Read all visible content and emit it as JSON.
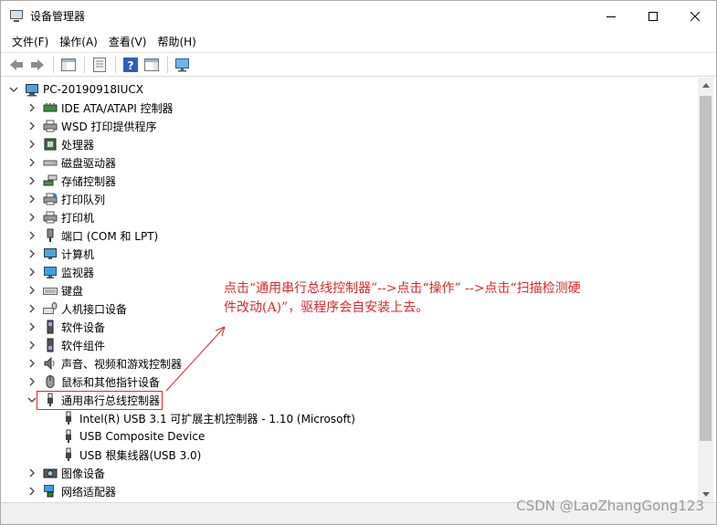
{
  "window": {
    "title": "设备管理器"
  },
  "menu": [
    "文件(F)",
    "操作(A)",
    "查看(V)",
    "帮助(H)"
  ],
  "tree": {
    "root": "PC-20190918IUCX",
    "categories": [
      {
        "label": "IDE ATA/ATAPI 控制器",
        "icon": "ide-controller-icon"
      },
      {
        "label": "WSD 打印提供程序",
        "icon": "printer-icon"
      },
      {
        "label": "处理器",
        "icon": "processor-icon"
      },
      {
        "label": "磁盘驱动器",
        "icon": "disk-drive-icon"
      },
      {
        "label": "存储控制器",
        "icon": "storage-controller-icon"
      },
      {
        "label": "打印队列",
        "icon": "print-queue-icon"
      },
      {
        "label": "打印机",
        "icon": "printer-icon"
      },
      {
        "label": "端口 (COM 和 LPT)",
        "icon": "port-icon"
      },
      {
        "label": "计算机",
        "icon": "computer-icon"
      },
      {
        "label": "监视器",
        "icon": "monitor-icon"
      },
      {
        "label": "键盘",
        "icon": "keyboard-icon"
      },
      {
        "label": "人机接口设备",
        "icon": "hid-icon"
      },
      {
        "label": "软件设备",
        "icon": "software-device-icon"
      },
      {
        "label": "软件组件",
        "icon": "software-component-icon"
      },
      {
        "label": "声音、视频和游戏控制器",
        "icon": "speaker-icon"
      },
      {
        "label": "鼠标和其他指针设备",
        "icon": "mouse-icon"
      },
      {
        "label": "通用串行总线控制器",
        "icon": "usb-icon",
        "expanded": true,
        "highlighted": true,
        "children": [
          "Intel(R) USB 3.1 可扩展主机控制器 - 1.10 (Microsoft)",
          "USB Composite Device",
          "USB 根集线器(USB 3.0)"
        ]
      },
      {
        "label": "图像设备",
        "icon": "camera-icon"
      },
      {
        "label": "网络适配器",
        "icon": "network-adapter-icon"
      }
    ]
  },
  "annotation": {
    "line1": "点击“通用串行总线控制器”-->点击“操作” -->点击“扫描检测硬",
    "line2": "件改动(A)”，驱程序会自安装上去。"
  },
  "watermark": "CSDN @LaoZhangGong123",
  "colors": {
    "annotation": "#e0272b",
    "highlight_border": "#e0272b"
  }
}
